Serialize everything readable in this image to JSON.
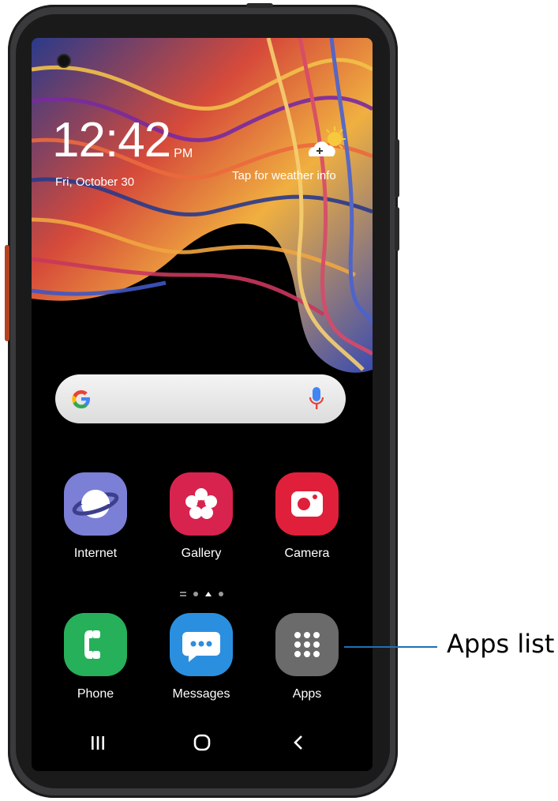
{
  "lockscreen": {
    "time": "12:42",
    "ampm": "PM",
    "date": "Fri, October 30",
    "weather_text": "Tap for weather info"
  },
  "search": {
    "logo": "google-g-icon",
    "mic": "microphone-icon"
  },
  "apps_row": [
    {
      "label": "Internet",
      "icon": "internet-icon",
      "color": "#7b7fd6"
    },
    {
      "label": "Gallery",
      "icon": "gallery-icon",
      "color": "#d8234e"
    },
    {
      "label": "Camera",
      "icon": "camera-icon",
      "color": "#e0203a"
    }
  ],
  "dock": [
    {
      "label": "Phone",
      "icon": "phone-icon",
      "color": "#26b05a"
    },
    {
      "label": "Messages",
      "icon": "messages-icon",
      "color": "#2b8fe0"
    },
    {
      "label": "Apps",
      "icon": "apps-grid-icon",
      "color": "#6b6b6b"
    }
  ],
  "navbar": [
    "recents-icon",
    "home-icon",
    "back-icon"
  ],
  "callout": {
    "label": "Apps list",
    "line_color": "#1f6fb6"
  }
}
